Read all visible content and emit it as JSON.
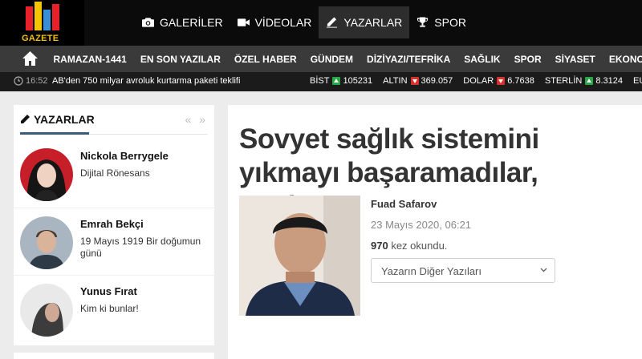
{
  "logo": {
    "text": "GAZETE"
  },
  "topnav": [
    {
      "label": "GALERİLER",
      "icon": "camera-icon"
    },
    {
      "label": "VİDEOLAR",
      "icon": "video-icon"
    },
    {
      "label": "YAZARLAR",
      "icon": "pencil-icon",
      "active": true
    },
    {
      "label": "SPOR",
      "icon": "trophy-icon"
    }
  ],
  "categories": [
    "RAMAZAN-1441",
    "EN SON YAZILAR",
    "ÖZEL HABER",
    "GÜNDEM",
    "DİZİYAZI/TEFRİKA",
    "SAĞLIK",
    "SPOR",
    "SİYASET",
    "EKONOMİ"
  ],
  "ticker": {
    "time": "16:52",
    "headline": "AB'den 750 milyar avroluk kurtarma paketi teklifi",
    "markets": [
      {
        "name": "BİST",
        "dir": "up",
        "value": "105231"
      },
      {
        "name": "ALTIN",
        "dir": "down",
        "value": "369.057"
      },
      {
        "name": "DOLAR",
        "dir": "down",
        "value": "6.7638"
      },
      {
        "name": "STERLİN",
        "dir": "up",
        "value": "8.3124"
      },
      {
        "name": "EURO",
        "dir": "up",
        "value": ""
      }
    ]
  },
  "sidebar": {
    "title": "YAZARLAR",
    "arrows": "« »",
    "authors": [
      {
        "name": "Nickola Berrygele",
        "title": "Dijital Rönesans"
      },
      {
        "name": "Emrah Bekçi",
        "title": "19 Mayıs 1919 Bir doğumun günü"
      },
      {
        "name": "Yunus Fırat",
        "title": "Kim ki bunlar!"
      }
    ]
  },
  "article": {
    "headline": "Sovyet sağlık sistemini yıkmayı başaramadılar, çünkü...",
    "author": "Fuad Safarov",
    "date": "23 Mayıs 2020, 06:21",
    "reads_count": "970",
    "reads_suffix": " kez okundu.",
    "select_label": "Yazarın Diğer Yazıları"
  },
  "colors": {
    "accent": "#3b5b7b",
    "up": "#27a745",
    "down": "#d9302c"
  }
}
